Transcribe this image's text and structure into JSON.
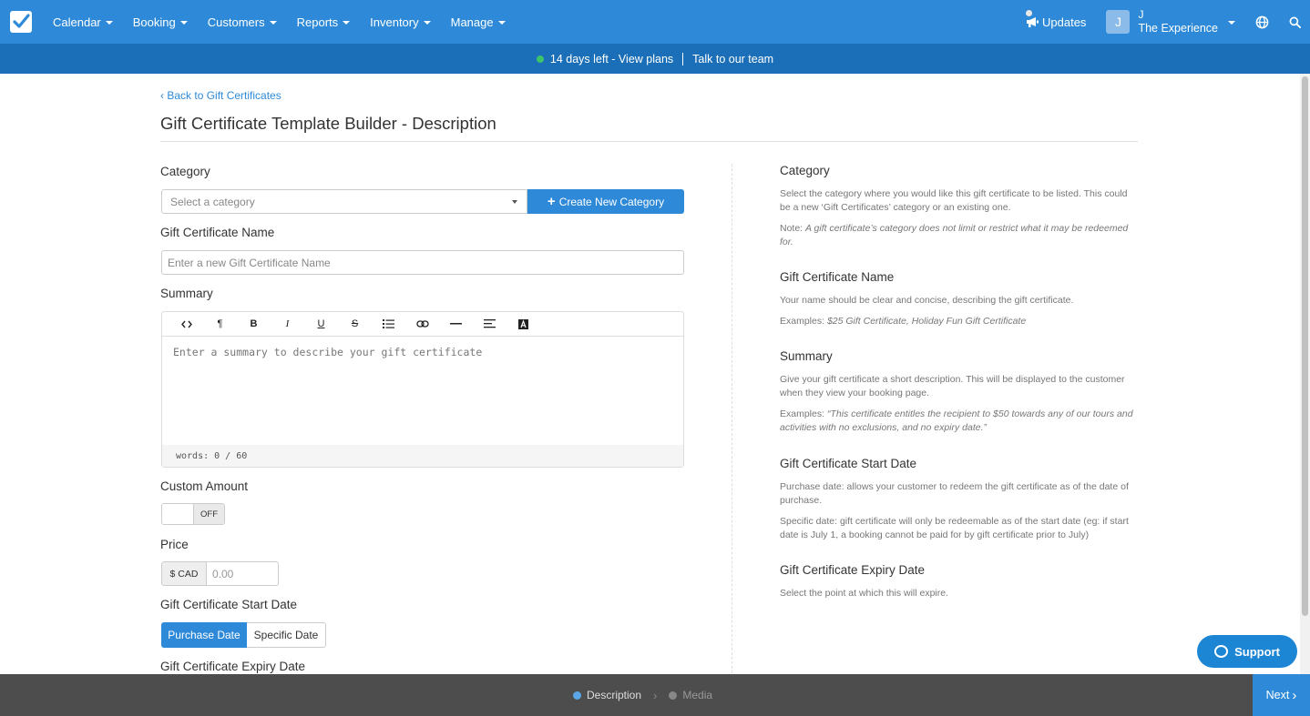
{
  "nav": {
    "items": [
      {
        "label": "Calendar"
      },
      {
        "label": "Booking"
      },
      {
        "label": "Customers"
      },
      {
        "label": "Reports"
      },
      {
        "label": "Inventory"
      },
      {
        "label": "Manage"
      }
    ],
    "updates_label": "Updates",
    "user_initial": "J",
    "user_name": "J",
    "org_name": "The Experience"
  },
  "trial": {
    "days_left": "14 days left - View plans",
    "talk": "Talk to our team"
  },
  "page": {
    "back_link": "Back to Gift Certificates",
    "title": "Gift Certificate Template Builder - Description"
  },
  "form": {
    "category_label": "Category",
    "category_placeholder": "Select a category",
    "create_category_button": "Create New Category",
    "name_label": "Gift Certificate Name",
    "name_placeholder": "Enter a new Gift Certificate Name",
    "summary_label": "Summary",
    "summary_placeholder": "Enter a summary to describe your gift certificate",
    "word_count": "words: 0 / 60",
    "custom_amount_label": "Custom Amount",
    "custom_amount_state": "OFF",
    "price_label": "Price",
    "price_currency": "$ CAD",
    "price_placeholder": "0.00",
    "start_date_label": "Gift Certificate Start Date",
    "start_date_options": [
      "Purchase Date",
      "Specific Date"
    ],
    "expiry_date_label": "Gift Certificate Expiry Date"
  },
  "help": {
    "category": {
      "title": "Category",
      "p1": "Select the category where you would like this gift certificate to be listed. This could be a new ‘Gift Certificates’ category or an existing one.",
      "note_prefix": "Note: ",
      "note": "A gift certificate’s category does not limit or restrict what it may be redeemed for."
    },
    "name": {
      "title": "Gift Certificate Name",
      "p1": "Your name should be clear and concise, describing the gift certificate.",
      "examples_prefix": "Examples: ",
      "examples": "$25 Gift Certificate, Holiday Fun Gift Certificate"
    },
    "summary": {
      "title": "Summary",
      "p1": "Give your gift certificate a short description. This will be displayed to the customer when they view your booking page.",
      "examples_prefix": "Examples: ",
      "examples": "“This certificate entitles the recipient to $50 towards any of our tours and activities with no exclusions, and no expiry date.”"
    },
    "start": {
      "title": "Gift Certificate Start Date",
      "p1": "Purchase date: allows your customer to redeem the gift certificate as of the date of purchase.",
      "p2": "Specific date: gift certificate will only be redeemable as of the start date (eg: if start date is July 1, a booking cannot be paid for by gift certificate prior to July)"
    },
    "expiry": {
      "title": "Gift Certificate Expiry Date",
      "p1": "Select the point at which this will expire."
    }
  },
  "support_label": "Support",
  "steps": {
    "step1": "Description",
    "step2": "Media",
    "next": "Next"
  },
  "colors": {
    "primary": "#2e8ad8",
    "trial_bar": "#1a6fb8",
    "bottom_bar": "#4d4d4d",
    "active_step": "#5aa6e6",
    "online_dot": "#3cc46b"
  }
}
